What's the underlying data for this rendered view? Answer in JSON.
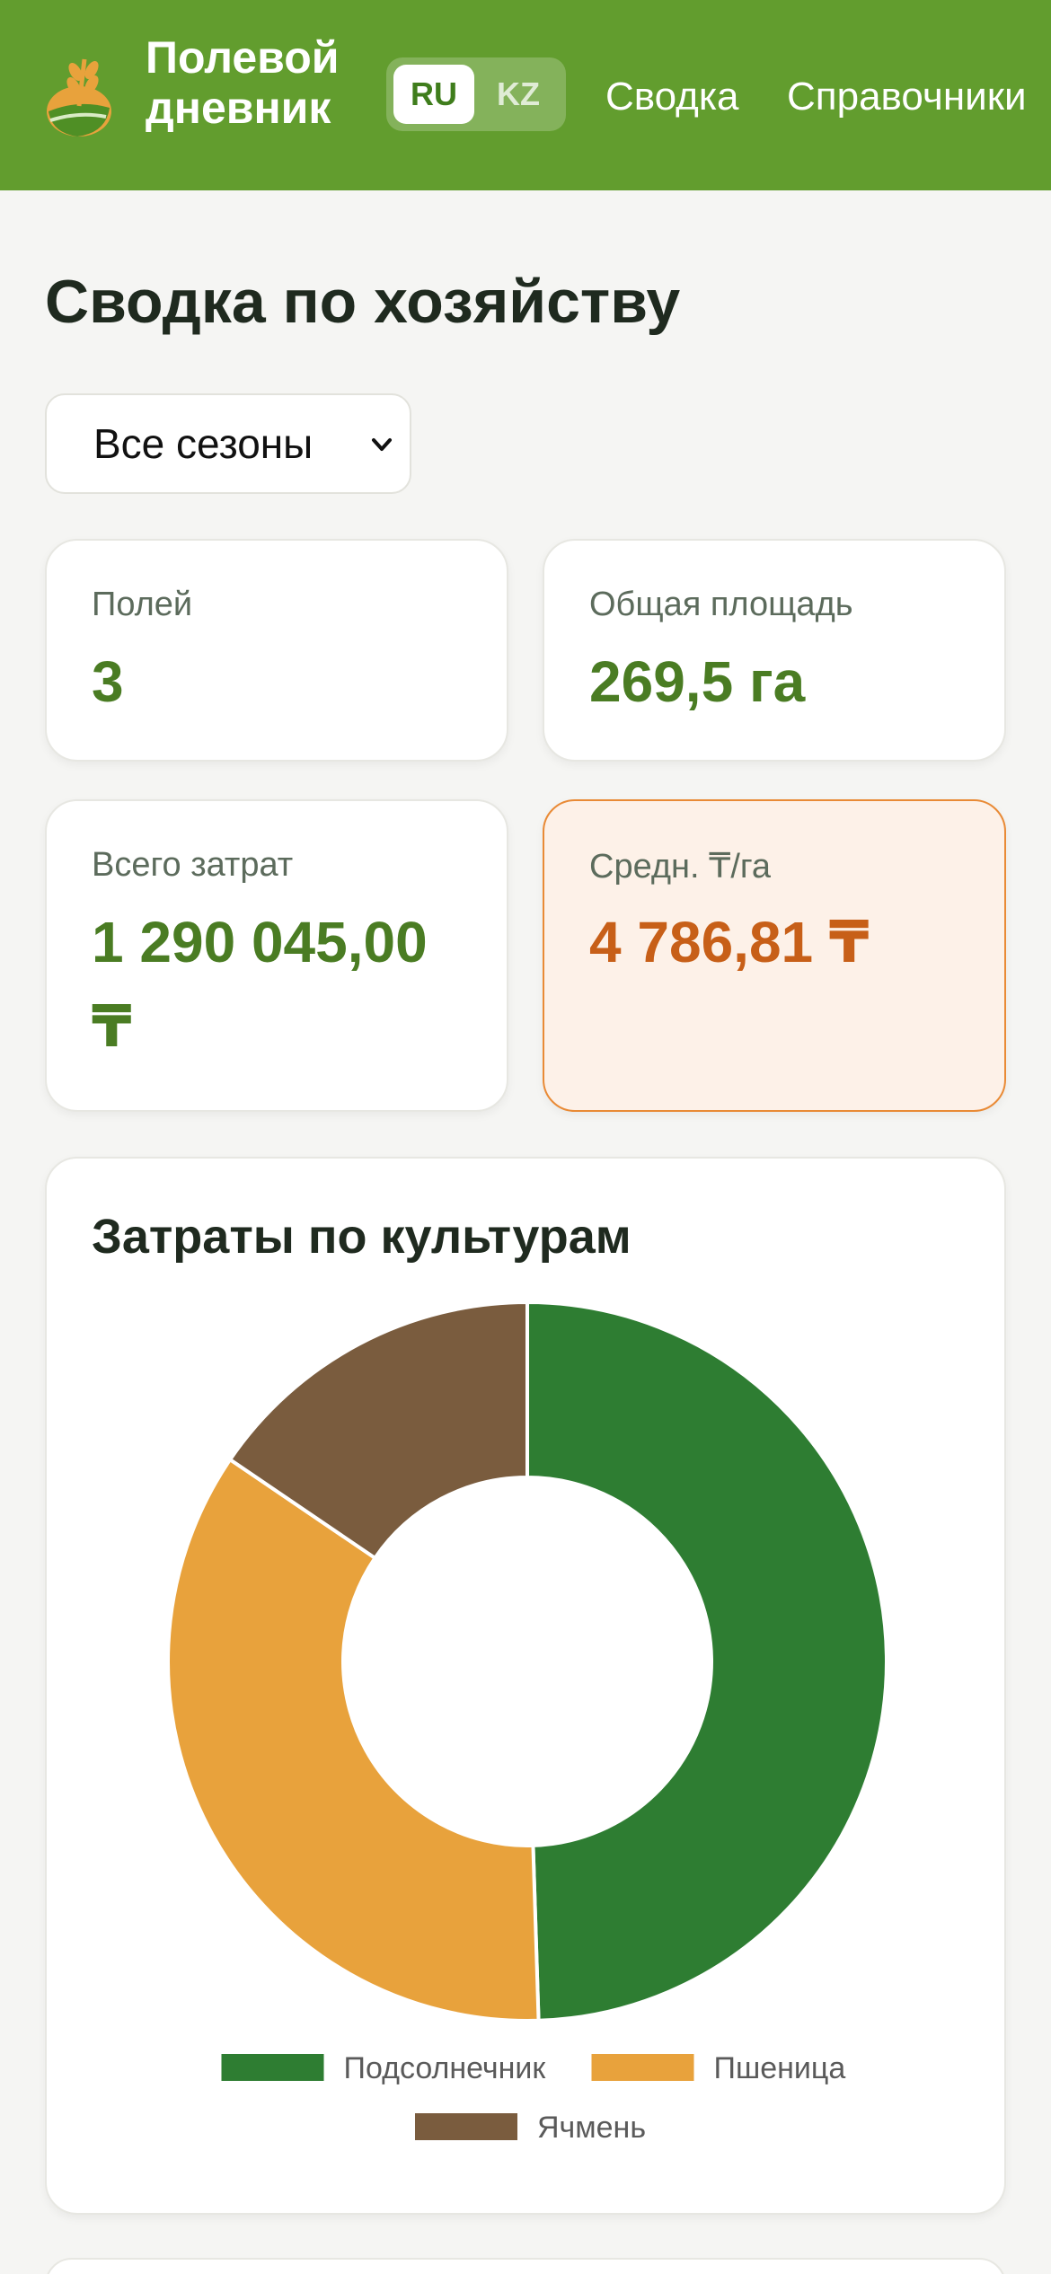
{
  "header": {
    "brand": "Полевой дневник",
    "lang_ru": "RU",
    "lang_kz": "KZ",
    "nav_summary": "Сводка",
    "nav_refs": "Справочники",
    "bg_color": "#629d2e"
  },
  "page_title": "Сводка по хозяйству",
  "season_select": {
    "value": "Все сезоны"
  },
  "stats": {
    "fields_label": "Полей",
    "fields_value": "3",
    "area_label": "Общая площадь",
    "area_value": "269,5 га",
    "costs_label": "Всего затрат",
    "costs_value": "1 290 045,00 ₸",
    "avg_label": "Средн. ₸/га",
    "avg_value": "4 786,81 ₸"
  },
  "chart_data": {
    "type": "pie",
    "title": "Затраты по культурам",
    "categories": [
      "Подсолнечник",
      "Пшеница",
      "Ячмень"
    ],
    "values": [
      49.5,
      35.0,
      15.5
    ],
    "colors": [
      "#2e7d32",
      "#e8a23c",
      "#7a5c3e"
    ],
    "donut": true,
    "legend": "bottom"
  }
}
